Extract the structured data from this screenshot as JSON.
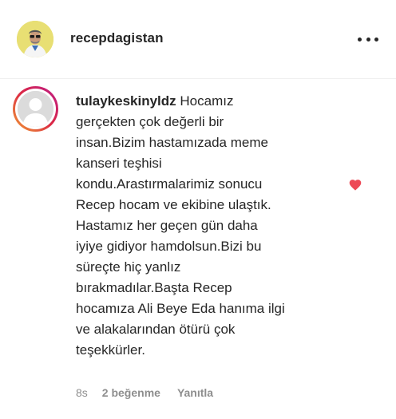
{
  "header": {
    "username": "recepdagistan",
    "avatar_icon": "profile-photo-icon",
    "more_icon": "more-options-icon"
  },
  "comment": {
    "author": "tulaykeskinyldz",
    "text": "Hocamız\ngerçekten çok değerli bir\ninsan.Bizim hastamızada meme\nkanseri teşhisi\nkondu.Arastırmalarimiz sonucu\nRecep hocam ve ekibine ulaştık.\nHastamız her geçen gün daha\niyiye gidiyor hamdolsun.Bizi bu\nsüreçte hiç yanlız\nbırakmadılar.Başta Recep\nhocamıza Ali Beye Eda hanıma ilgi\nve alakalarından ötürü çok\nteşekkürler.",
    "time": "8s",
    "likes": "2 beğenme",
    "reply_label": "Yanıtla",
    "liked": true,
    "heart_color": "#ed4956",
    "ring_colors": [
      "#f09433",
      "#dc2743",
      "#bc1888"
    ]
  }
}
